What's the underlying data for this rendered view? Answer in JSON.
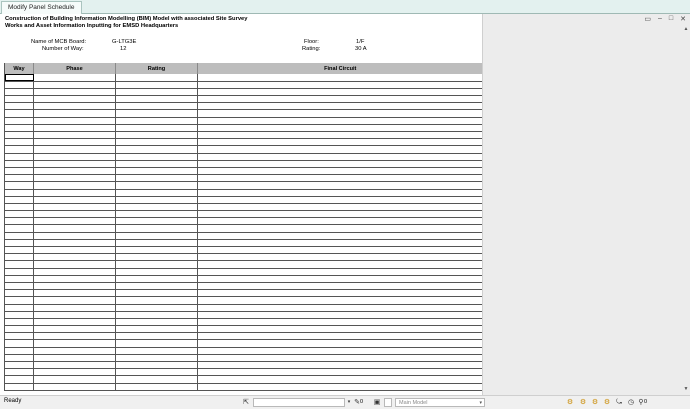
{
  "tab": {
    "title": "Modify Panel Schedule"
  },
  "document": {
    "title_line1": "Construction of Building Information Modelling (BIM) Model with associated Site Survey",
    "title_line2": "Works and Asset Information Inputting for EMSD Headquarters",
    "board_label": "Name of MCB Board:",
    "board_value": "G-LTG3E",
    "way_label": "Number of Way:",
    "way_value": "12",
    "floor_label": "Floor:",
    "floor_value": "1/F",
    "rating_label": "Rating:",
    "rating_value": "30 A"
  },
  "schedule": {
    "columns": [
      "Way",
      "Phase",
      "Rating",
      "Final Circuit"
    ],
    "row_count": 44
  },
  "status": {
    "text": "Ready",
    "zero_a": "0",
    "zero_b": "0",
    "model_placeholder": "Main Model",
    "zero_c": "0"
  },
  "icons": {
    "window": [
      "restore-icon",
      "minimize-icon",
      "maximize-icon",
      "close-icon"
    ],
    "statusbar": [
      "select-icon",
      "filter-icon",
      "design-options-icon",
      "workset-icon",
      "editable-icon",
      "link-icon",
      "pinned-icon",
      "underlay-icon",
      "face-select-icon",
      "drag-icon",
      "filter-count-icon"
    ]
  }
}
